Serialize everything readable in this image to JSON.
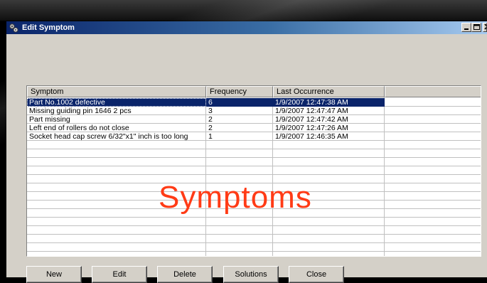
{
  "window": {
    "title": "Edit Symptom"
  },
  "grid": {
    "columns": [
      "Symptom",
      "Frequency",
      "Last Occurrence",
      ""
    ],
    "rows": [
      {
        "symptom": "Part No.1002 defective",
        "frequency": "6",
        "last": "1/9/2007 12:47:38 AM",
        "selected": true
      },
      {
        "symptom": "Missing guiding pin 1646 2 pcs",
        "frequency": "3",
        "last": "1/9/2007 12:47:47 AM",
        "selected": false
      },
      {
        "symptom": "Part missing",
        "frequency": "2",
        "last": "1/9/2007 12:47:42 AM",
        "selected": false
      },
      {
        "symptom": "Left end of rollers do not close",
        "frequency": "2",
        "last": "1/9/2007 12:47:26 AM",
        "selected": false
      },
      {
        "symptom": "Socket head cap screw 6/32\"x1\" inch is too long",
        "frequency": "1",
        "last": "1/9/2007 12:46:35 AM",
        "selected": false
      }
    ],
    "empty_rows": 13
  },
  "overlay": {
    "caption": "Symptoms",
    "color": "#ff3b16"
  },
  "buttons": {
    "new": "New",
    "edit": "Edit",
    "delete": "Delete",
    "solutions": "Solutions",
    "close": "Close"
  },
  "colors": {
    "selection": "#0a246a",
    "face": "#d4d0c8"
  },
  "icons": {
    "app": "gears-icon",
    "minimize": "minimize-icon",
    "maximize": "maximize-icon",
    "close": "close-icon"
  }
}
